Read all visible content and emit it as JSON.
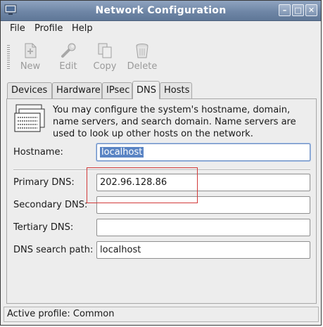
{
  "window": {
    "title": "Network Configuration",
    "buttons": [
      "minimize",
      "maximize",
      "close"
    ]
  },
  "menubar": {
    "items": [
      {
        "label": "File",
        "mnemonic": "F"
      },
      {
        "label": "Profile",
        "mnemonic": "P"
      },
      {
        "label": "Help",
        "mnemonic": "H"
      }
    ]
  },
  "toolbar": {
    "items": [
      {
        "label": "New",
        "icon": "new-document-icon",
        "enabled": false
      },
      {
        "label": "Edit",
        "icon": "wrench-icon",
        "enabled": false
      },
      {
        "label": "Copy",
        "icon": "copy-icon",
        "enabled": false
      },
      {
        "label": "Delete",
        "icon": "trash-icon",
        "enabled": false
      }
    ]
  },
  "tabs": [
    {
      "label": "Devices",
      "active": false
    },
    {
      "label": "Hardware",
      "active": false
    },
    {
      "label": "IPsec",
      "active": false
    },
    {
      "label": "DNS",
      "active": true
    },
    {
      "label": "Hosts",
      "active": false
    }
  ],
  "dns": {
    "info_text": "You may configure the system's hostname, domain, name servers, and search domain. Name servers are used to look up other hosts on the network.",
    "hostname_label": "Hostname:",
    "hostname_value": "localhost",
    "primary_dns_label": "Primary DNS:",
    "primary_dns_value": "202.96.128.86",
    "secondary_dns_label": "Secondary DNS:",
    "secondary_dns_value": "",
    "tertiary_dns_label": "Tertiary DNS:",
    "tertiary_dns_value": "",
    "search_path_label": "DNS search path:",
    "search_path_value": "localhost"
  },
  "status": {
    "text": "Active profile: Common"
  },
  "colors": {
    "titlebar": "#6f86a6",
    "selection": "#5a84c4",
    "highlight_box": "#d23a3a",
    "background": "#ededed"
  }
}
